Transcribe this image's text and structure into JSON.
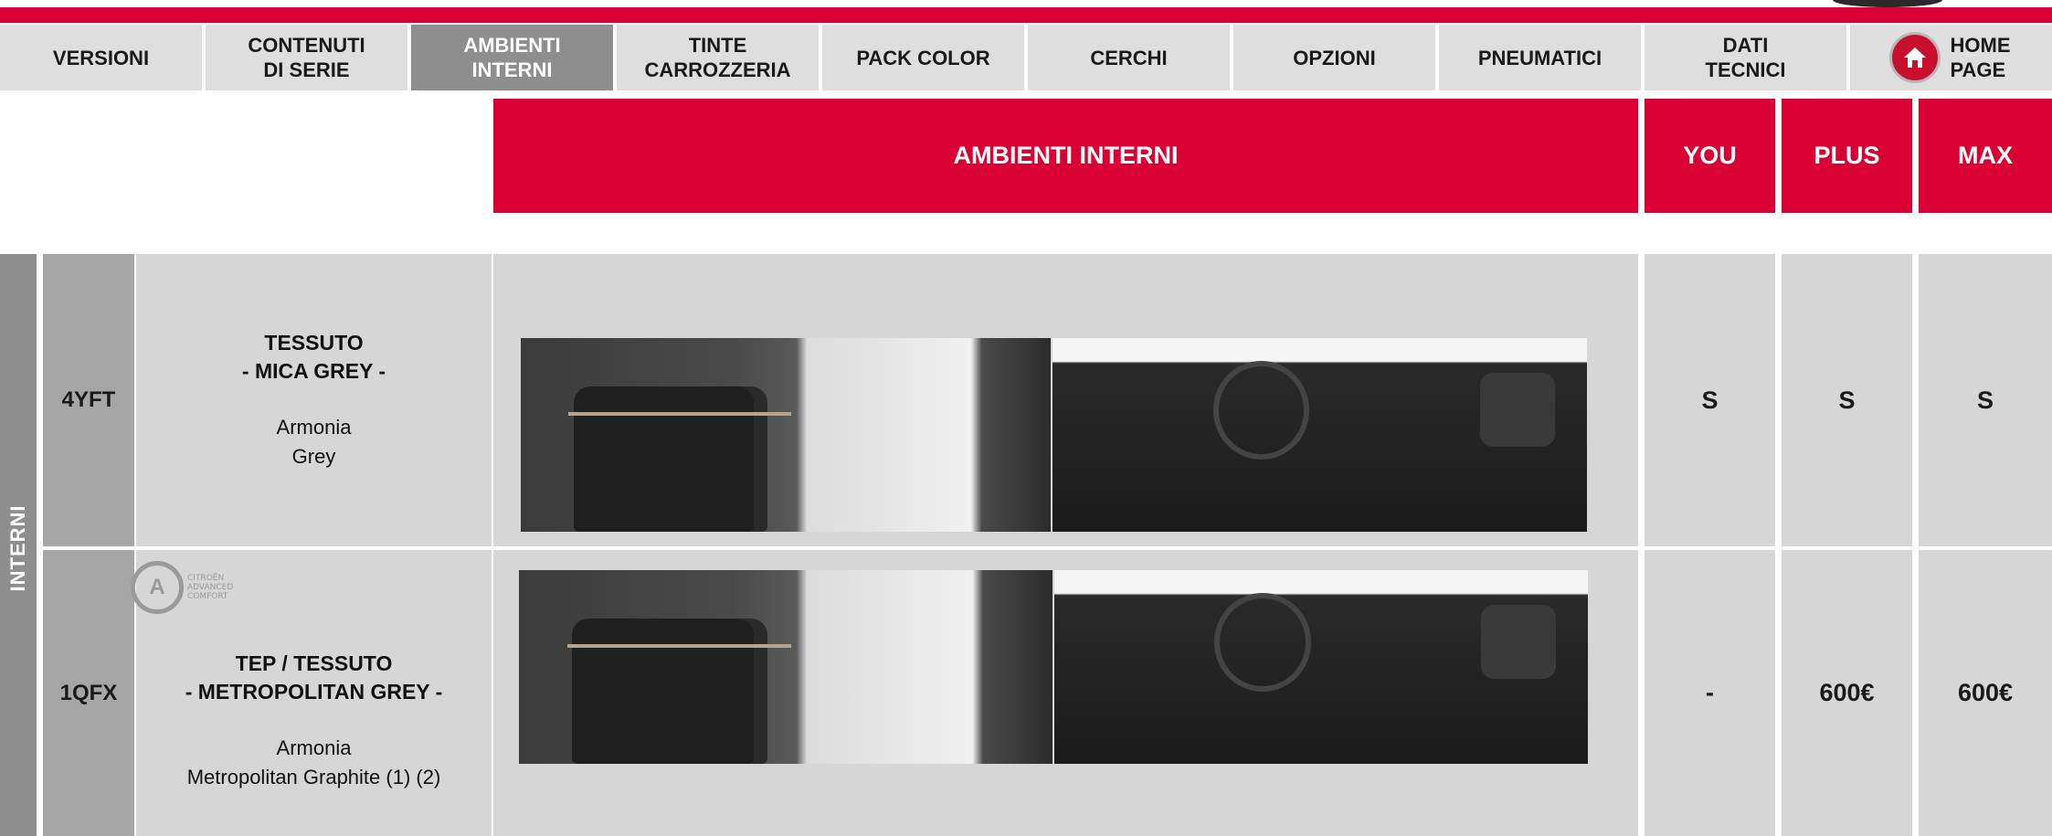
{
  "nav": {
    "items": [
      {
        "label": "VERSIONI",
        "active": false
      },
      {
        "label": "CONTENUTI\nDI SERIE",
        "active": false
      },
      {
        "label": "AMBIENTI\nINTERNI",
        "active": true
      },
      {
        "label": "TINTE\nCARROZZERIA",
        "active": false
      },
      {
        "label": "PACK COLOR",
        "active": false
      },
      {
        "label": "CERCHI",
        "active": false
      },
      {
        "label": "OPZIONI",
        "active": false
      },
      {
        "label": "PNEUMATICI",
        "active": false
      },
      {
        "label": "DATI\nTECNICI",
        "active": false
      }
    ],
    "home_label": "HOME\nPAGE",
    "home_icon": "home-icon"
  },
  "header": {
    "title": "AMBIENTI INTERNI",
    "columns": [
      "YOU",
      "PLUS",
      "MAX"
    ]
  },
  "section_label": "INTERNI",
  "rows": [
    {
      "code": "4YFT",
      "title": "TESSUTO",
      "subtitle": "- MICA GREY -",
      "line1": "Armonia",
      "line2": "Grey",
      "values": [
        "S",
        "S",
        "S"
      ]
    },
    {
      "code": "1QFX",
      "title": "TEP / TESSUTO",
      "subtitle": "- METROPOLITAN GREY -",
      "line1": "Armonia",
      "line2": "Metropolitan Graphite (1) (2)",
      "values": [
        "-",
        "600€",
        "600€"
      ]
    }
  ],
  "badge": {
    "letter": "A",
    "text": "CITROËN\nADVANCED\nCOMFORT"
  },
  "colors": {
    "brand_red": "#d90033",
    "active_tab": "#8e8e8e",
    "cell_bg": "#d6d6d6"
  }
}
